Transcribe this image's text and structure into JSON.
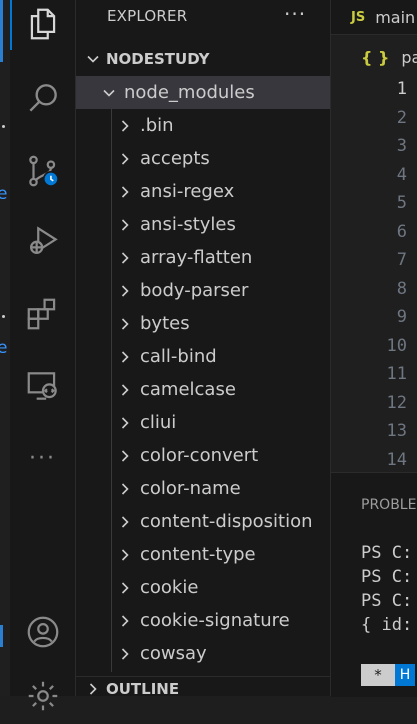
{
  "sidebar": {
    "title": "EXPLORER",
    "actions_icon": "more-actions-icon",
    "workspace": "NODESTUDY",
    "folder": "node_modules",
    "items": [
      ".bin",
      "accepts",
      "ansi-regex",
      "ansi-styles",
      "array-flatten",
      "body-parser",
      "bytes",
      "call-bind",
      "camelcase",
      "cliui",
      "color-convert",
      "color-name",
      "content-disposition",
      "content-type",
      "cookie",
      "cookie-signature",
      "cowsay"
    ],
    "outline": "OUTLINE"
  },
  "activity_bar": {
    "items": [
      "explorer-icon",
      "search-icon",
      "source-control-icon",
      "run-debug-icon",
      "extensions-icon",
      "remote-explorer-icon",
      "more-icon",
      "account-icon",
      "settings-icon"
    ],
    "more_label": "···"
  },
  "editor": {
    "tab_badge": "JS",
    "tab_label": "main",
    "breadcrumb_icon": "{ }",
    "breadcrumb_text": "pac",
    "line_numbers": [
      "1",
      "2",
      "3",
      "4",
      "5",
      "6",
      "7",
      "8",
      "9",
      "10",
      "11",
      "12",
      "13",
      "14"
    ],
    "current_line": "1"
  },
  "panel": {
    "tab_label": "PROBLE",
    "terminal_lines": [
      "PS C:",
      "PS C:",
      "PS C:",
      "{ id:"
    ],
    "chip_star": "*",
    "chip_label": "H"
  },
  "colors": {
    "accent": "#0078d4",
    "js_badge": "#cbcb41",
    "selection": "#37373d"
  }
}
